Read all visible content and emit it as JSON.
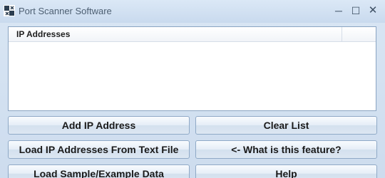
{
  "window": {
    "title": "Port Scanner Software",
    "minimize_glyph": "─",
    "maximize_glyph": "☐",
    "close_glyph": "✕"
  },
  "list": {
    "column_header": "IP Addresses",
    "rows": []
  },
  "buttons": {
    "add_ip": "Add IP Address",
    "clear_list": "Clear List",
    "load_from_file": "Load IP Addresses From Text File",
    "what_is_feature": "<- What is this feature?",
    "load_sample": "Load Sample/Example Data",
    "help": "Help"
  },
  "colors": {
    "accent": "#8aa4c2",
    "background": "#dfeaf5"
  }
}
